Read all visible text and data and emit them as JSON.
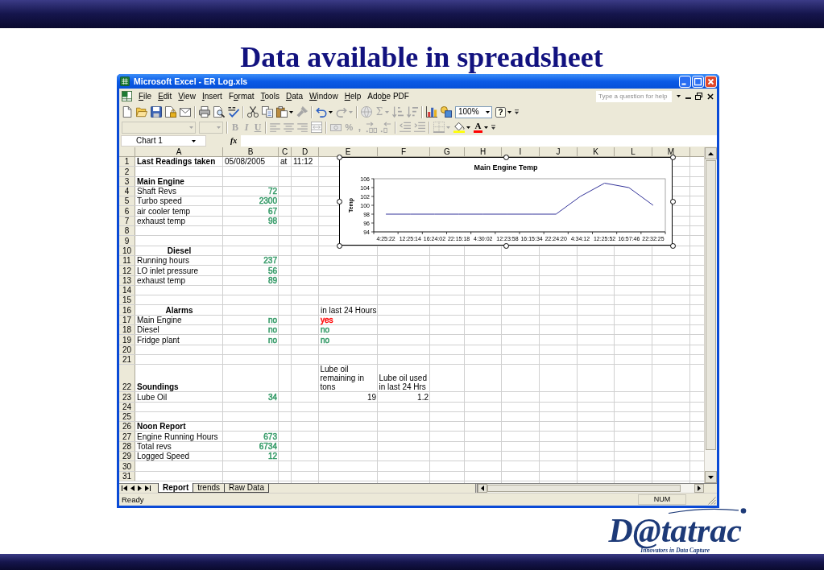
{
  "slide": {
    "title": "Data available in spreadsheet"
  },
  "excel": {
    "title": "Microsoft Excel - ER Log.xls",
    "menu": [
      {
        "key": "F",
        "post": "ile"
      },
      {
        "key": "E",
        "post": "dit"
      },
      {
        "key": "V",
        "post": "iew"
      },
      {
        "key": "I",
        "post": "nsert"
      },
      {
        "pre": "F",
        "key": "o",
        "post": "rmat"
      },
      {
        "key": "T",
        "post": "ools"
      },
      {
        "key": "D",
        "post": "ata"
      },
      {
        "key": "W",
        "post": "indow"
      },
      {
        "key": "H",
        "post": "elp"
      },
      {
        "pre": "Ado",
        "key": "b",
        "post": "e PDF"
      }
    ],
    "help_box": {
      "placeholder": "Type a question for help"
    },
    "standard_toolbar": {
      "items": [
        {
          "kind": "icon",
          "disabled": false
        },
        {
          "kind": "icon",
          "disabled": false
        },
        {
          "kind": "icon",
          "disabled": false
        },
        {
          "kind": "icon",
          "disabled": false
        },
        {
          "kind": "icon",
          "disabled": false
        },
        {
          "kind": "icon",
          "disabled": false
        },
        {
          "kind": "icon",
          "disabled": false
        },
        {
          "kind": "icon",
          "disabled": false
        },
        {
          "kind": "icon",
          "disabled": false
        },
        {
          "kind": "icon",
          "disabled": false
        },
        {
          "kind": "icon",
          "disabled": false,
          "dropdown": true
        },
        {
          "kind": "icon",
          "disabled": true
        },
        {
          "kind": "icon",
          "disabled": false,
          "dropdown": true
        },
        {
          "kind": "icon",
          "disabled": true,
          "dropdown": true
        },
        {
          "kind": "icon",
          "disabled": true
        },
        {
          "kind": "glyph",
          "label": "Σ",
          "disabled": true,
          "dropdown": true
        },
        {
          "kind": "icon",
          "disabled": true
        },
        {
          "kind": "icon",
          "disabled": true
        },
        {
          "kind": "icon",
          "disabled": false
        },
        {
          "kind": "icon",
          "disabled": false
        },
        {
          "kind": "combo",
          "label": "100%",
          "disabled": false
        },
        {
          "kind": "glyph",
          "label": "?",
          "disabled": false,
          "dropdown": true
        },
        {
          "kind": "icon",
          "disabled": false
        }
      ]
    },
    "formatting_toolbar": {
      "items": [
        {
          "kind": "combo",
          "disabled": true
        },
        {
          "kind": "combo",
          "disabled": true
        },
        {
          "kind": "glyph",
          "label": "B",
          "disabled": true
        },
        {
          "kind": "glyph",
          "label": "I",
          "disabled": true
        },
        {
          "kind": "glyph",
          "label": "U",
          "disabled": true
        },
        {
          "kind": "icon",
          "disabled": true
        },
        {
          "kind": "icon",
          "disabled": true
        },
        {
          "kind": "icon",
          "disabled": true
        },
        {
          "kind": "icon",
          "disabled": true
        },
        {
          "kind": "icon",
          "disabled": true
        },
        {
          "kind": "glyph",
          "label": "%",
          "disabled": true
        },
        {
          "kind": "glyph",
          "label": ",",
          "disabled": true
        },
        {
          "kind": "icon",
          "disabled": true
        },
        {
          "kind": "icon",
          "disabled": true
        },
        {
          "kind": "icon",
          "disabled": true
        },
        {
          "kind": "icon",
          "disabled": true
        },
        {
          "kind": "icon",
          "disabled": true,
          "dropdown": true
        },
        {
          "kind": "icon",
          "disabled": false,
          "dropdown": true
        },
        {
          "kind": "glyph",
          "label": "A",
          "disabled": false,
          "dropdown": true
        },
        {
          "kind": "icon",
          "disabled": false
        }
      ]
    },
    "formula_bar": {
      "name_box": "Chart 1",
      "function_label": "fx"
    },
    "columns": [
      "A",
      "B",
      "C",
      "D",
      "E",
      "F",
      "G",
      "H",
      "I",
      "J",
      "K",
      "L",
      "M"
    ],
    "rows": [
      {
        "n": "1",
        "cells": [
          {
            "kind": "heading",
            "text": "Last Readings taken"
          },
          {
            "kind": "label",
            "text": "05/08/2005"
          },
          {
            "kind": "label",
            "text": "at"
          },
          {
            "kind": "label",
            "text": "11:12"
          }
        ]
      },
      {
        "n": "2"
      },
      {
        "n": "3",
        "cells": [
          {
            "kind": "heading",
            "text": "Main Engine"
          }
        ]
      },
      {
        "n": "4",
        "cells": [
          {
            "kind": "label",
            "text": "Shaft Revs"
          },
          {
            "kind": "value",
            "text": "72",
            "color": "#339966"
          }
        ]
      },
      {
        "n": "5",
        "cells": [
          {
            "kind": "label",
            "text": "Turbo speed"
          },
          {
            "kind": "value",
            "text": "2300",
            "color": "#339966"
          }
        ]
      },
      {
        "n": "6",
        "cells": [
          {
            "kind": "label",
            "text": "air cooler temp"
          },
          {
            "kind": "value",
            "text": "67",
            "color": "#339966"
          }
        ]
      },
      {
        "n": "7",
        "cells": [
          {
            "kind": "label",
            "text": "exhaust temp"
          },
          {
            "kind": "value",
            "text": "98",
            "color": "#339966"
          }
        ]
      },
      {
        "n": "8"
      },
      {
        "n": "9"
      },
      {
        "n": "10",
        "cells": [
          {
            "kind": "section",
            "text": "Diesel"
          }
        ]
      },
      {
        "n": "11",
        "cells": [
          {
            "kind": "label",
            "text": "Running hours"
          },
          {
            "kind": "value",
            "text": "237",
            "color": "#339966"
          }
        ]
      },
      {
        "n": "12",
        "cells": [
          {
            "kind": "label",
            "text": "LO inlet pressure"
          },
          {
            "kind": "value",
            "text": "56",
            "color": "#339966"
          }
        ]
      },
      {
        "n": "13",
        "cells": [
          {
            "kind": "label",
            "text": "exhaust temp"
          },
          {
            "kind": "value",
            "text": "89",
            "color": "#339966"
          }
        ]
      },
      {
        "n": "14"
      },
      {
        "n": "15"
      },
      {
        "n": "16",
        "cells": [
          {
            "kind": "section",
            "text": "Alarms"
          },
          null,
          null,
          null,
          {
            "kind": "label",
            "text": "in last 24 Hours"
          }
        ]
      },
      {
        "n": "17",
        "cells": [
          {
            "kind": "label",
            "text": "Main Engine"
          },
          {
            "kind": "value",
            "text": "no",
            "color": "#339966"
          },
          null,
          null,
          {
            "kind": "label",
            "text": "yes",
            "color": "#ff0000"
          }
        ]
      },
      {
        "n": "18",
        "cells": [
          {
            "kind": "label",
            "text": "Diesel"
          },
          {
            "kind": "value",
            "text": "no",
            "color": "#339966"
          },
          null,
          null,
          {
            "kind": "label",
            "text": "no",
            "color": "#339966"
          }
        ]
      },
      {
        "n": "19",
        "cells": [
          {
            "kind": "label",
            "text": "Fridge plant"
          },
          {
            "kind": "value",
            "text": "no",
            "color": "#339966"
          },
          null,
          null,
          {
            "kind": "label",
            "text": "no",
            "color": "#339966"
          }
        ]
      },
      {
        "n": "20"
      },
      {
        "n": "21"
      },
      {
        "n": "22",
        "cells": [
          {
            "kind": "heading",
            "text": "Soundings"
          },
          null,
          null,
          null,
          {
            "kind": "wrap",
            "text": "Lube oil remaining in tons"
          },
          {
            "kind": "wrap",
            "text": "Lube oil used in last 24 Hrs"
          }
        ]
      },
      {
        "n": "23",
        "cells": [
          {
            "kind": "label",
            "text": "Lube Oil"
          },
          {
            "kind": "value",
            "text": "34",
            "color": "#339966"
          },
          null,
          null,
          {
            "kind": "value",
            "text": "19"
          },
          {
            "kind": "value",
            "text": "1.2"
          }
        ]
      },
      {
        "n": "24"
      },
      {
        "n": "25"
      },
      {
        "n": "26",
        "cells": [
          {
            "kind": "heading",
            "text": "Noon Report"
          }
        ]
      },
      {
        "n": "27",
        "cells": [
          {
            "kind": "label",
            "text": "Engine Running Hours"
          },
          {
            "kind": "value",
            "text": "673",
            "color": "#339966"
          }
        ]
      },
      {
        "n": "28",
        "cells": [
          {
            "kind": "label",
            "text": "Total revs"
          },
          {
            "kind": "value",
            "text": "6734",
            "color": "#339966"
          }
        ]
      },
      {
        "n": "29",
        "cells": [
          {
            "kind": "label",
            "text": "Logged Speed"
          },
          {
            "kind": "value",
            "text": "12",
            "color": "#339966"
          }
        ]
      },
      {
        "n": "30"
      },
      {
        "n": "31"
      }
    ],
    "chart": {
      "chart_data": {
        "type": "line",
        "title": "Main Engine Temp",
        "ylabel": "Temp",
        "categories": [
          "4:25:22",
          "12:25:14",
          "16:24:02",
          "22:15:18",
          "4:30:02",
          "12:23:58",
          "16:15:34",
          "22:24:20",
          "4:34:12",
          "12:25:52",
          "16:57:46",
          "22:32:25"
        ],
        "series": [
          {
            "color": "#333399",
            "values": [
              98,
              98,
              98,
              98,
              98,
              98,
              98,
              98,
              102,
              105,
              104,
              100
            ]
          }
        ],
        "ylim": [
          94,
          106
        ],
        "yticks": [
          94,
          96,
          98,
          100,
          102,
          104,
          106
        ]
      }
    },
    "sheet_tabs": [
      {
        "label": "Report",
        "selected": true
      },
      {
        "label": "trends",
        "selected": false
      },
      {
        "label": "Raw Data",
        "selected": false
      }
    ],
    "status_bar": {
      "message": "Ready",
      "indicator": "NUM"
    }
  },
  "logo": {
    "name": "D@tatrac",
    "tagline": "Innovators in Data Capture"
  }
}
